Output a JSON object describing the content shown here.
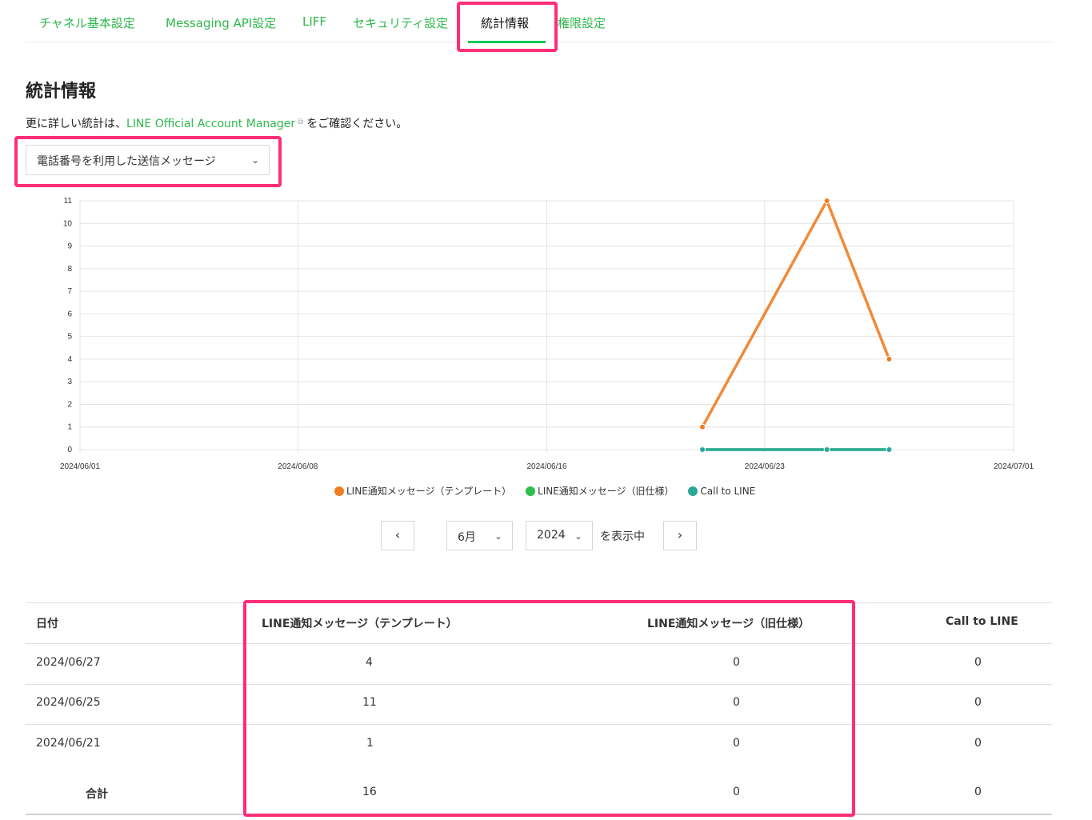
{
  "tabs": [
    {
      "label": "チャネル基本設定"
    },
    {
      "label": "Messaging API設定"
    },
    {
      "label": "LIFF"
    },
    {
      "label": "セキュリティ設定"
    },
    {
      "label": "統計情報"
    },
    {
      "label": "権限設定"
    }
  ],
  "page": {
    "title": "統計情報",
    "desc_prefix": "更に詳しい統計は、",
    "desc_link": "LINE Official Account Manager",
    "desc_suffix": "をご確認ください。"
  },
  "dropdown": {
    "value": "電話番号を利用した送信メッセージ"
  },
  "icons": {
    "external": "external-link-icon",
    "chevron": "chevron-down-icon",
    "prev": "chevron-left-icon",
    "next": "chevron-right-icon"
  },
  "colors": {
    "accent": "#06c755",
    "template": "#ef7d22",
    "legacy": "#2fbe4b",
    "call": "#2aa89a",
    "highlight": "#ff2d78"
  },
  "chart_data": {
    "type": "line",
    "x_ticks": [
      "2024/06/01",
      "2024/06/08",
      "2024/06/16",
      "2024/06/23",
      "2024/07/01"
    ],
    "y_ticks": [
      0,
      1,
      2,
      3,
      4,
      5,
      6,
      7,
      8,
      9,
      10,
      11
    ],
    "ylim": [
      0,
      11
    ],
    "grid": true,
    "legend_position": "bottom",
    "series": [
      {
        "name": "LINE通知メッセージ（テンプレート）",
        "color": "#ef7d22",
        "x": [
          "2024/06/21",
          "2024/06/25",
          "2024/06/27"
        ],
        "values": [
          1,
          11,
          4
        ]
      },
      {
        "name": "LINE通知メッセージ（旧仕様）",
        "color": "#2fbe4b",
        "x": [
          "2024/06/21",
          "2024/06/25",
          "2024/06/27"
        ],
        "values": [
          0,
          0,
          0
        ]
      },
      {
        "name": "Call to LINE",
        "color": "#2aa89a",
        "x": [
          "2024/06/21",
          "2024/06/25",
          "2024/06/27"
        ],
        "values": [
          0,
          0,
          0
        ]
      }
    ]
  },
  "pager": {
    "month": "6月",
    "year": "2024",
    "label": "を表示中"
  },
  "table": {
    "headers": [
      "日付",
      "LINE通知メッセージ（テンプレート）",
      "LINE通知メッセージ（旧仕様）",
      "Call to LINE"
    ],
    "rows": [
      [
        "2024/06/27",
        "4",
        "0",
        "0"
      ],
      [
        "2024/06/25",
        "11",
        "0",
        "0"
      ],
      [
        "2024/06/21",
        "1",
        "0",
        "0"
      ]
    ],
    "total": [
      "合計",
      "16",
      "0",
      "0"
    ]
  }
}
